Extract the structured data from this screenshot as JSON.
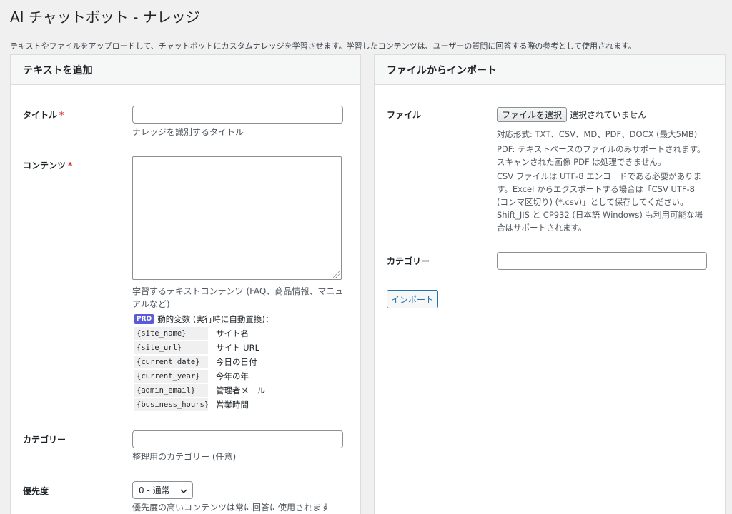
{
  "page": {
    "title": "AI チャットボット - ナレッジ",
    "description": "テキストやファイルをアップロードして、チャットボットにカスタムナレッジを学習させます。学習したコンテンツは、ユーザーの質問に回答する際の参考として使用されます。"
  },
  "left_card": {
    "header": "テキストを追加",
    "title_label": "タイトル",
    "required_mark": "*",
    "title_value": "",
    "title_help": "ナレッジを識別するタイトル",
    "content_label": "コンテンツ",
    "content_value": "",
    "content_help_line1": "学習するテキストコンテンツ (FAQ、商品情報、マニュ",
    "content_help_line2": "アルなど)",
    "pro_badge": "PRO",
    "dynamic_vars_label": "動的変数 (実行時に自動置換)：",
    "variables": [
      {
        "code": "{site_name}",
        "desc": "サイト名"
      },
      {
        "code": "{site_url}",
        "desc": "サイト URL"
      },
      {
        "code": "{current_date}",
        "desc": "今日の日付"
      },
      {
        "code": "{current_year}",
        "desc": "今年の年"
      },
      {
        "code": "{admin_email}",
        "desc": "管理者メール"
      },
      {
        "code": "{business_hours}",
        "desc": "営業時間"
      }
    ],
    "category_label": "カテゴリー",
    "category_value": "",
    "category_help": "整理用のカテゴリー (任意)",
    "priority_label": "優先度",
    "priority_selected": "0 - 通常",
    "priority_help": "優先度の高いコンテンツは常に回答に使用されます"
  },
  "right_card": {
    "header": "ファイルからインポート",
    "file_label": "ファイル",
    "choose_file_button": "ファイルを選択",
    "no_file_text": "選択されていません",
    "formats_help": "対応形式: TXT、CSV、MD、PDF、DOCX (最大5MB)",
    "pdf_help_line1": "PDF: テキストベースのファイルのみサポートされます。",
    "pdf_help_line2": "スキャンされた画像 PDF は処理できません。",
    "csv_help_line1": "CSV ファイルは UTF-8 エンコードである必要がありま",
    "csv_help_line2": "す。Excel からエクスポートする場合は「CSV UTF-8",
    "csv_help_line3": "(コンマ区切り) (*.csv)」として保存してください。",
    "csv_help_line4": "Shift_JIS と CP932 (日本語 Windows) も利用可能な場",
    "csv_help_line5": "合はサポートされます。",
    "category_label": "カテゴリー",
    "category_value": "",
    "import_button": "インポート"
  }
}
